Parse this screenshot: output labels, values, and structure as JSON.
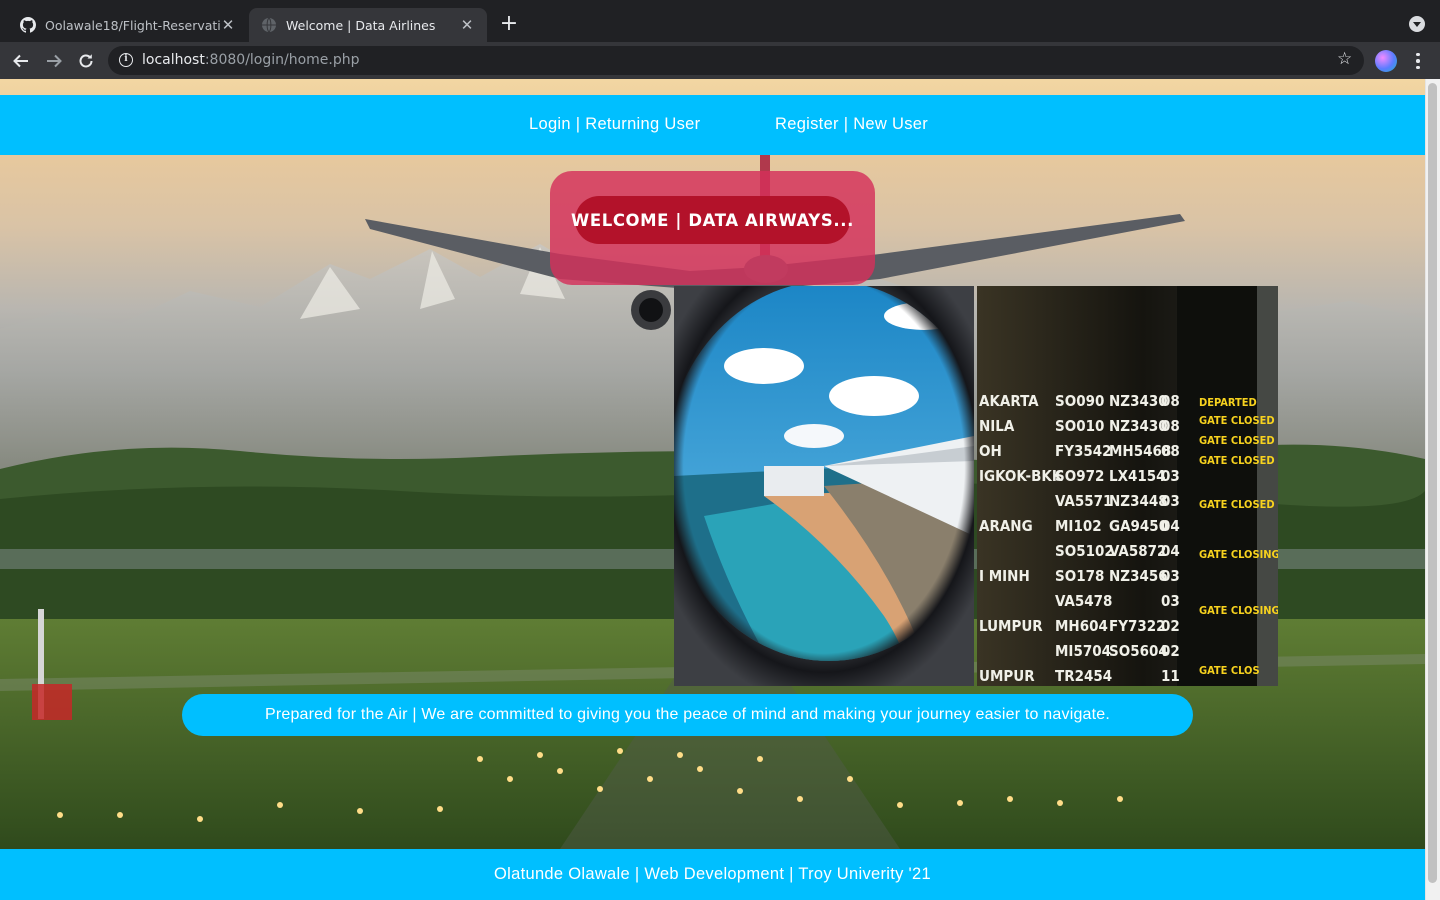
{
  "browser": {
    "tabs": [
      {
        "title": "Oolawale18/Flight-Reservation",
        "favicon": "github-icon",
        "active": false
      },
      {
        "title": "Welcome | Data Airlines",
        "favicon": "globe-icon",
        "active": true
      }
    ],
    "url_host": "localhost",
    "url_rest": ":8080/login/home.php"
  },
  "nav": {
    "login": "Login | Returning User",
    "register": "Register | New User"
  },
  "welcome": {
    "title": "WELCOME | DATA AIRWAYS..."
  },
  "tagline": "Prepared for the Air | We are committed to giving you the peace of mind and making your journey easier to navigate.",
  "footer": "Olatunde Olawale | Web Development | Troy Univerity '21",
  "board_rows": [
    {
      "city": "AKARTA",
      "f1": "SO090",
      "f2": "NZ3430",
      "gate": "08"
    },
    {
      "city": "NILA",
      "f1": "SO010",
      "f2": "NZ3430",
      "gate": "08"
    },
    {
      "city": "OH",
      "f1": "FY3542",
      "f2": "MH5468",
      "gate": "08"
    },
    {
      "city": "IGKOK-BKK",
      "f1": "SO972",
      "f2": "LX4154",
      "gate": "03"
    },
    {
      "city": "",
      "f1": "VA5571",
      "f2": "NZ3448",
      "gate": "03"
    },
    {
      "city": "ARANG",
      "f1": "MI102",
      "f2": "GA9450",
      "gate": "04"
    },
    {
      "city": "",
      "f1": "SO5102",
      "f2": "VA5872",
      "gate": "04"
    },
    {
      "city": "I MINH",
      "f1": "SO178",
      "f2": "NZ3456",
      "gate": "03"
    },
    {
      "city": "",
      "f1": "VA5478",
      "f2": "",
      "gate": "03"
    },
    {
      "city": "LUMPUR",
      "f1": "MH604",
      "f2": "FY7322",
      "gate": "02"
    },
    {
      "city": "",
      "f1": "MI5704",
      "f2": "SO5604",
      "gate": "02"
    },
    {
      "city": "UMPUR",
      "f1": "TR2454",
      "f2": "",
      "gate": "11"
    }
  ],
  "board_status": [
    "DEPARTED",
    "GATE CLOSED",
    "GATE CLOSED",
    "GATE CLOSED",
    "GATE CLOSED",
    "GATE CLOSING",
    "GATE CLOSING",
    "GATE CLOS"
  ],
  "colors": {
    "nav_bg": "#00bfff",
    "welcome_panel": "#d4305a",
    "welcome_pill": "#b3122a",
    "board_text": "#f0f0e8",
    "board_status": "#f7d21e"
  }
}
